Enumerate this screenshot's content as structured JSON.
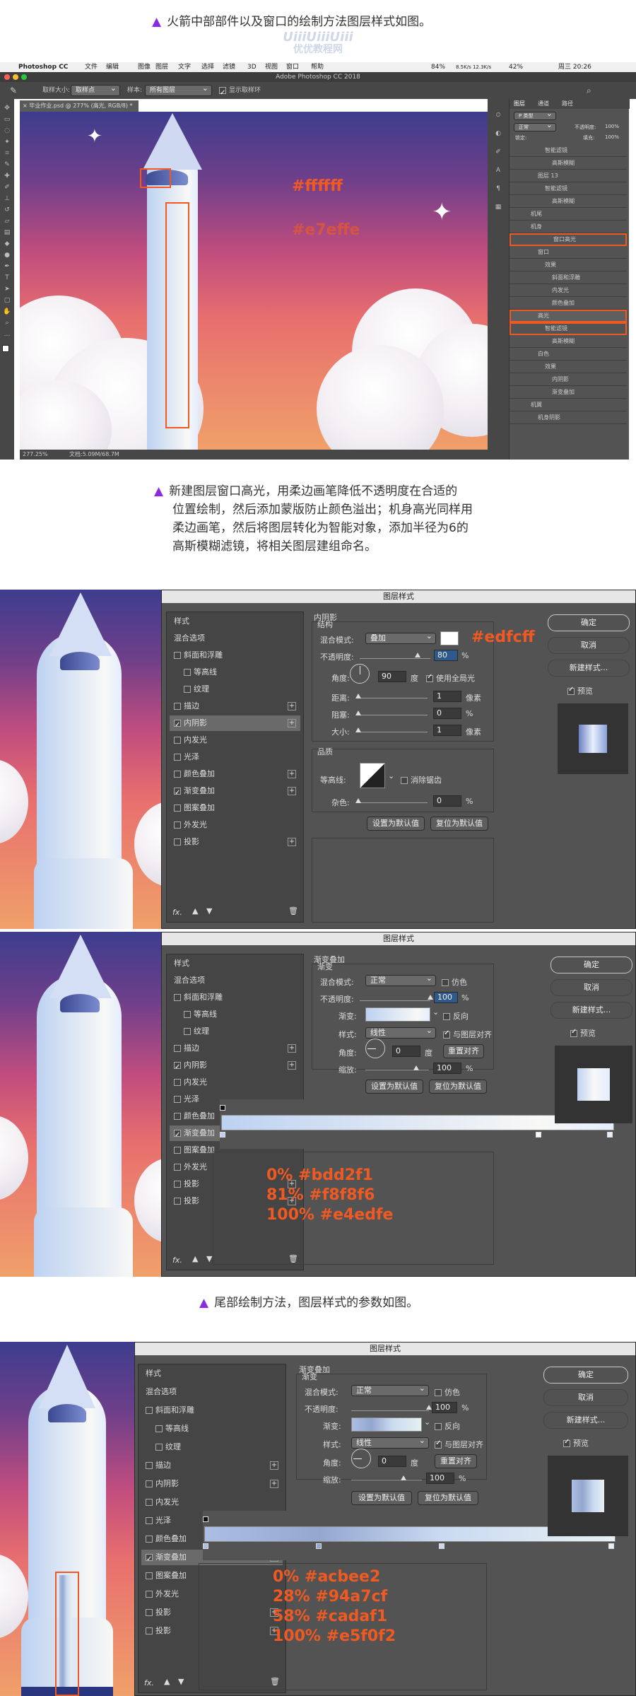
{
  "step1": {
    "text": "火箭中部部件以及窗口的绘制方法图层样式如图。"
  },
  "watermark": {
    "brand": "UiiiUiiiUiii",
    "cn": "优优教程网"
  },
  "mac_menu": {
    "app": "Photoshop CC",
    "items": [
      "文件",
      "编辑",
      "图像",
      "图层",
      "文字",
      "选择",
      "滤镜",
      "3D",
      "视图",
      "窗口",
      "帮助"
    ],
    "status_battery": "84%",
    "status_net": "8.5K/s 12.3K/s",
    "status_wifi": "42%",
    "time": "周三 20:26"
  },
  "ps": {
    "window_title": "Adobe Photoshop CC 2018",
    "options": {
      "brush_label": "取样大小:",
      "brush_value": "取样点",
      "sample_label": "样本:",
      "sample_value": "所有图层",
      "ring": "显示取样环"
    },
    "doc_tab": "毕业作业.psd @ 277% (高光, RGB/8) *",
    "zoom": "277.25%",
    "doc_info": "文档:5.09M/68.7M",
    "annot_window": "#ffffff",
    "annot_body": "#e7effe",
    "panel_tabs": [
      "图层",
      "通道",
      "路径"
    ],
    "filter_kind": "P 类型",
    "blend_mode": "正常",
    "opacity_label": "不透明度:",
    "opacity": "100%",
    "lock_label": "锁定:",
    "fill_label": "填充:",
    "fill": "100%",
    "layers": [
      "智能滤镜",
      "高斯模糊",
      "图层 13",
      "智能滤镜",
      "高斯模糊",
      "机尾",
      "机身",
      "窗口高光",
      "窗口",
      "效果",
      "斜面和浮雕",
      "内发光",
      "颜色叠加",
      "高光",
      "智能滤镜",
      "高斯模糊",
      "白色",
      "效果",
      "内阴影",
      "渐变叠加",
      "机翼",
      "机身阴影"
    ]
  },
  "step2": {
    "lines": [
      "新建图层窗口高光，用柔边画笔降低不透明度在合适的",
      "位置绘制，然后添加蒙版防止颜色溢出；机身高光同样用",
      "柔边画笔，然后将图层转化为智能对象，添加半径为6的",
      "高斯模糊滤镜，将相关图层建组命名。"
    ]
  },
  "step3": {
    "text": "尾部绘制方法，图层样式的参数如图。"
  },
  "dialog_title": "图层样式",
  "style_list": {
    "styles_header": "样式",
    "blend_options": "混合选项",
    "items": [
      "斜面和浮雕",
      "等高线",
      "纹理",
      "描边",
      "内阴影",
      "内发光",
      "光泽",
      "颜色叠加",
      "渐变叠加",
      "图案叠加",
      "外发光",
      "投影"
    ]
  },
  "right_buttons": {
    "ok": "确定",
    "cancel": "取消",
    "new_style": "新建样式...",
    "preview": "预览"
  },
  "d1": {
    "section": "内阴影",
    "group": "结构",
    "blend_label": "混合模式:",
    "blend": "叠加",
    "opacity_label": "不透明度:",
    "opacity": "80",
    "pct": "%",
    "angle_label": "角度:",
    "angle": "90",
    "deg": "度",
    "global": "使用全局光",
    "distance_label": "距离:",
    "distance": "1",
    "px": "像素",
    "choke_label": "阻塞:",
    "choke": "0",
    "size_label": "大小:",
    "size": "1",
    "quality": "品质",
    "contour_label": "等高线:",
    "antialias": "消除锯齿",
    "noise_label": "杂色:",
    "noise": "0",
    "set_default": "设置为默认值",
    "reset_default": "复位为默认值",
    "annot": "#edfcff"
  },
  "d2": {
    "section": "渐变叠加",
    "group": "渐变",
    "blend_label": "混合模式:",
    "blend": "正常",
    "dither": "仿色",
    "opacity_label": "不透明度:",
    "opacity": "100",
    "pct": "%",
    "gradient_label": "渐变:",
    "reverse": "反向",
    "style_label": "样式:",
    "style": "线性",
    "align": "与图层对齐",
    "angle_label": "角度:",
    "angle": "0",
    "deg": "度",
    "reset_align": "重置对齐",
    "scale_label": "缩放:",
    "scale": "100",
    "set_default": "设置为默认值",
    "reset_default": "复位为默认值",
    "stops": [
      {
        "pos": "0%",
        "color": "#bdd2f1"
      },
      {
        "pos": "81%",
        "color": "#f8f8f6"
      },
      {
        "pos": "100%",
        "color": "#e4edfe"
      }
    ]
  },
  "d3": {
    "section": "渐变叠加",
    "group": "渐变",
    "blend_label": "混合模式:",
    "blend": "正常",
    "dither": "仿色",
    "opacity_label": "不透明度:",
    "opacity": "100",
    "pct": "%",
    "gradient_label": "渐变:",
    "reverse": "反向",
    "style_label": "样式:",
    "style": "线性",
    "align": "与图层对齐",
    "angle_label": "角度:",
    "angle": "0",
    "deg": "度",
    "reset_align": "重置对齐",
    "scale_label": "缩放:",
    "scale": "100",
    "set_default": "设置为默认值",
    "reset_default": "复位为默认值",
    "stops": [
      {
        "pos": "0%",
        "color": "#acbee2"
      },
      {
        "pos": "28%",
        "color": "#94a7cf"
      },
      {
        "pos": "58%",
        "color": "#cadaf1"
      },
      {
        "pos": "100%",
        "color": "#e5f0f2"
      }
    ]
  },
  "colors": {
    "accent_orange": "#f05a22",
    "accent_purple": "#8a2be2"
  }
}
